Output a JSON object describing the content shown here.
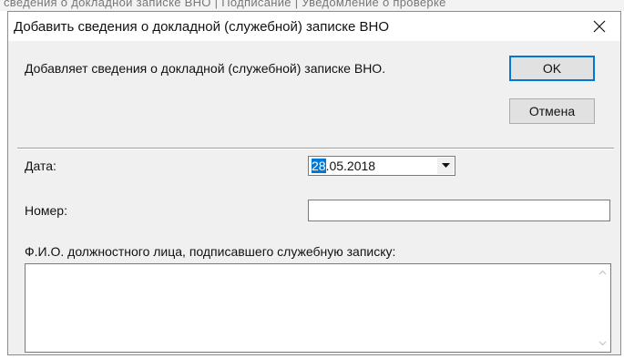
{
  "background_window": {
    "text": "сведения о докладной записке ВНО | Подписание | Уведомление о проверке"
  },
  "dialog": {
    "title": "Добавить сведения о докладной (служебной) записке ВНО",
    "description": "Добавляет сведения о докладной (служебной) записке ВНО.",
    "ok_label": "OK",
    "cancel_label": "Отмена",
    "date_label": "Дата:",
    "date_day": "28",
    "date_rest": ".05.2018",
    "number_label": "Номер:",
    "number_value": "",
    "official_label": "Ф.И.О. должностного лица, подписавшего служебную записку:",
    "official_value": ""
  },
  "icons": {
    "close": "close-icon",
    "dropdown": "chevron-down-icon",
    "scroll_up": "scroll-up-arrow-icon",
    "scroll_down": "scroll-down-arrow-icon"
  },
  "colors": {
    "selection": "#0078d7",
    "dialog_bg": "#f0f0f0",
    "default_button_border": "#0078d7"
  }
}
